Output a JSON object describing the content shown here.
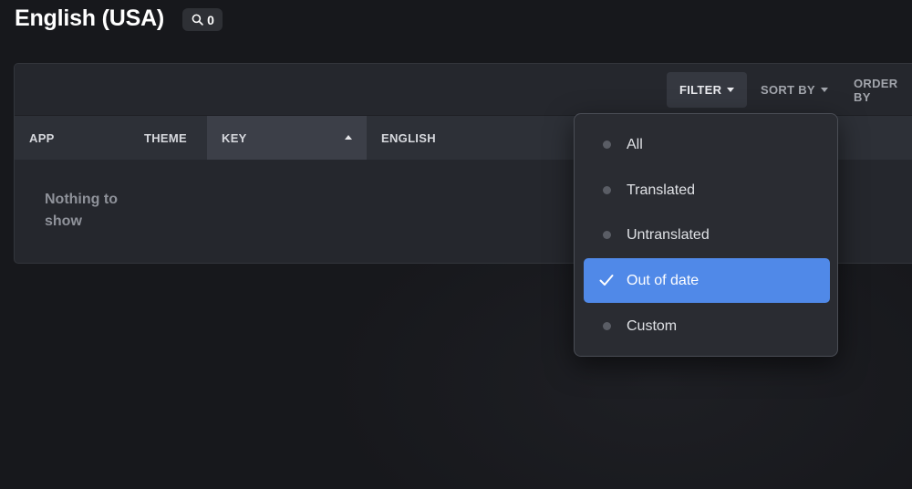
{
  "header": {
    "title": "English (USA)",
    "search_count": "0",
    "search_icon": "search-icon"
  },
  "toolbar": {
    "filter_label": "FILTER",
    "sort_by_label": "SORT BY",
    "order_by_label": "ORDER BY"
  },
  "table": {
    "columns": [
      {
        "label": "APP"
      },
      {
        "label": "THEME"
      },
      {
        "label": "KEY",
        "sorted": "ascending"
      },
      {
        "label": "ENGLISH"
      }
    ],
    "empty_text": "Nothing to show"
  },
  "filter_menu": {
    "items": [
      {
        "label": "All",
        "selected": false
      },
      {
        "label": "Translated",
        "selected": false
      },
      {
        "label": "Untranslated",
        "selected": false
      },
      {
        "label": "Out of date",
        "selected": true
      },
      {
        "label": "Custom",
        "selected": false
      }
    ]
  },
  "colors": {
    "background": "#17181c",
    "panel": "#25272d",
    "selected_item": "#5089e8"
  }
}
